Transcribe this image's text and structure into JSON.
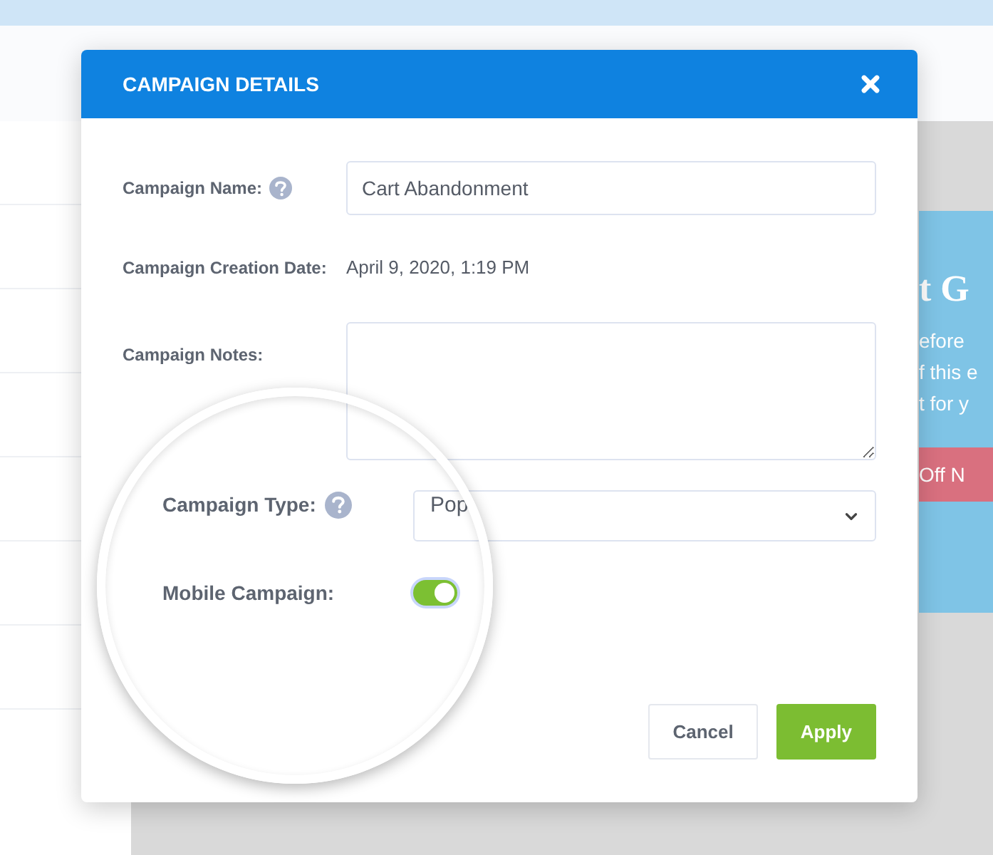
{
  "header": {
    "title": "CAMPAIGN DETAILS"
  },
  "fields": [
    {
      "kind": "text",
      "label": "Campaign Name:",
      "help": true,
      "value": "Cart Abandonment"
    },
    {
      "kind": "static",
      "label": "Campaign Creation Date:",
      "value": "April 9, 2020, 1:19 PM"
    },
    {
      "kind": "textarea",
      "label": "Campaign Notes:"
    }
  ],
  "magnified_fields": [
    {
      "kind": "select",
      "label": "Campaign Type:",
      "help": true,
      "value": "Pop"
    },
    {
      "kind": "toggle",
      "label": "Mobile Campaign:",
      "on": true
    }
  ],
  "buttons": [
    {
      "kind": "secondary",
      "label": "Cancel"
    },
    {
      "kind": "primary",
      "label": "Apply"
    }
  ],
  "background_preview": {
    "heading": "t G",
    "lines": [
      "efore",
      "f this e",
      "t for y"
    ],
    "button": "Off N"
  }
}
